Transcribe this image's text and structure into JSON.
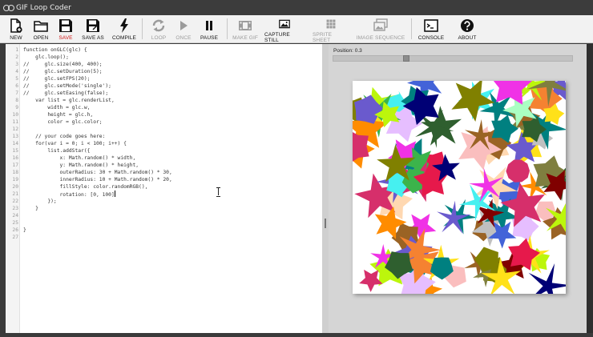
{
  "window": {
    "title": "GIF Loop Coder"
  },
  "toolbar": {
    "new": "NEW",
    "open": "OPEN",
    "save": "SAVE",
    "save_as": "SAVE AS",
    "compile": "COMPILE",
    "loop": "LOOP",
    "once": "ONCE",
    "pause": "PAUSE",
    "make_gif": "MAKE GIF",
    "capture_still": "CAPTURE STILL",
    "sprite_sheet": "SPRITE SHEET",
    "image_sequence": "IMAGE SEQUENCE",
    "console": "CONSOLE",
    "about": "ABOUT"
  },
  "editor": {
    "line_numbers": [
      "1",
      "2",
      "3",
      "4",
      "5",
      "6",
      "7",
      "8",
      "9",
      "10",
      "11",
      "12",
      "13",
      "14",
      "15",
      "16",
      "17",
      "18",
      "19",
      "20",
      "21",
      "22",
      "23",
      "24",
      "25",
      "26",
      "27"
    ],
    "lines": [
      "function onGLC(glc) {",
      "    glc.loop();",
      "//     glc.size(400, 400);",
      "//     glc.setDuration(5);",
      "//     glc.setFPS(20);",
      "//     glc.setMode('single');",
      "//     glc.setEasing(false);",
      "    var list = glc.renderList,",
      "        width = glc.w,",
      "        height = glc.h,",
      "        color = glc.color;",
      "",
      "    // your code goes here:",
      "    for(var i = 0; i < 100; i++) {",
      "        list.addStar({",
      "            x: Math.random() * width,",
      "            y: Math.random() * height,",
      "            outerRadius: 30 + Math.random() * 30,",
      "            innerRadius: 10 + Math.random() * 20,",
      "            fillStyle: color.randomRGB(),",
      "            rotation: [0, 100]",
      "        });",
      "    }",
      "",
      "",
      "}",
      ""
    ]
  },
  "preview": {
    "position_label": "Position: 0.3",
    "position_value": 0.3
  }
}
